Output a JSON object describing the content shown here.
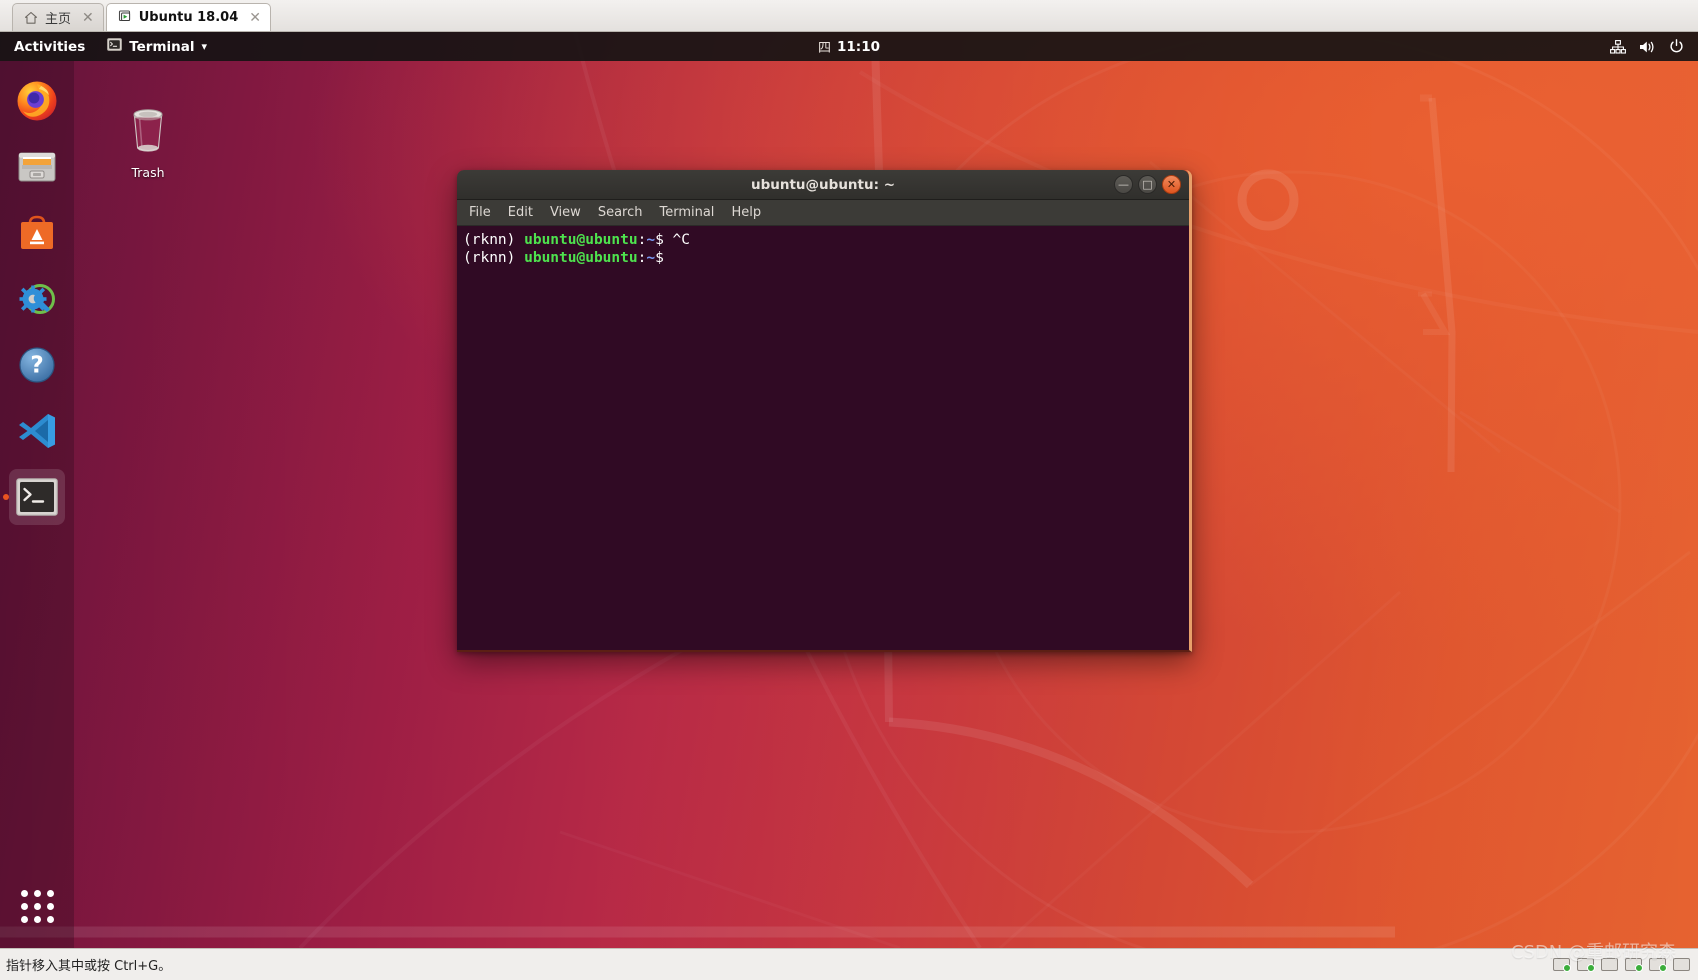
{
  "vm_tabbar": {
    "tabs": [
      {
        "label": "主页",
        "icon": "home-icon",
        "close_glyph": "✕",
        "active": false
      },
      {
        "label": "Ubuntu 18.04",
        "icon": "vm-running-icon",
        "close_glyph": "✕",
        "active": true
      }
    ]
  },
  "topbar": {
    "activities_label": "Activities",
    "appmenu_label": "Terminal",
    "appmenu_icon": "terminal-icon",
    "appmenu_arrow": "▾",
    "clock": {
      "day": "四",
      "time": "11:10"
    },
    "tray": [
      {
        "name": "network-icon"
      },
      {
        "name": "volume-icon"
      },
      {
        "name": "power-icon"
      }
    ]
  },
  "dock": {
    "items": [
      {
        "name": "firefox",
        "label": "Firefox Web Browser",
        "running": false
      },
      {
        "name": "files",
        "label": "Files",
        "running": false
      },
      {
        "name": "ubuntu-software",
        "label": "Ubuntu Software",
        "running": false
      },
      {
        "name": "software-updater",
        "label": "Software Updater",
        "running": false
      },
      {
        "name": "help",
        "label": "Help",
        "running": false
      },
      {
        "name": "vscode",
        "label": "Visual Studio Code",
        "running": false
      },
      {
        "name": "terminal",
        "label": "Terminal",
        "running": true
      }
    ],
    "app_grid_label": "Show Applications"
  },
  "desktop": {
    "icons": [
      {
        "name": "trash",
        "label": "Trash"
      }
    ]
  },
  "terminal": {
    "title": "ubuntu@ubuntu: ~",
    "window_controls": {
      "minimize": "—",
      "maximize": "□",
      "close": "✕"
    },
    "menu": [
      "File",
      "Edit",
      "View",
      "Search",
      "Terminal",
      "Help"
    ],
    "lines": [
      {
        "venv": "(rknn) ",
        "user": "ubuntu@ubuntu",
        "colon": ":",
        "path": "~",
        "dollar": "$ ",
        "output": "^C"
      },
      {
        "venv": "(rknn) ",
        "user": "ubuntu@ubuntu",
        "colon": ":",
        "path": "~",
        "dollar": "$",
        "output": ""
      }
    ]
  },
  "statusbar": {
    "hint": "指针移入其中或按 Ctrl+G。"
  },
  "watermark": {
    "text": "CSDN @重邮研究森"
  },
  "colors": {
    "ubuntu_orange": "#e95420",
    "terminal_bg": "#300a24",
    "topbar_bg": "#161314",
    "prompt_green": "#4ee24e",
    "prompt_blue": "#7b9bf5"
  }
}
